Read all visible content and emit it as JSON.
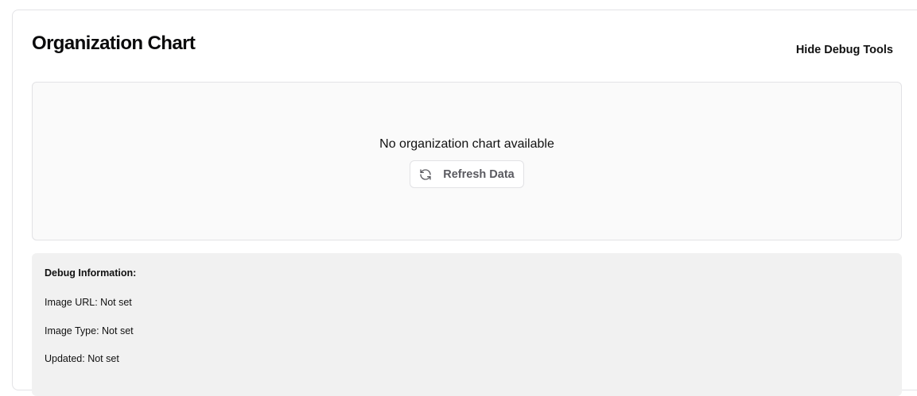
{
  "header": {
    "title": "Organization Chart",
    "debug_toggle_label": "Hide Debug Tools"
  },
  "chart_panel": {
    "empty_message": "No organization chart available",
    "refresh_label": "Refresh Data",
    "refresh_icon": "refresh-icon"
  },
  "debug": {
    "heading": "Debug Information:",
    "lines": [
      "Image URL: Not set",
      "Image Type: Not set",
      "Updated: Not set"
    ]
  }
}
